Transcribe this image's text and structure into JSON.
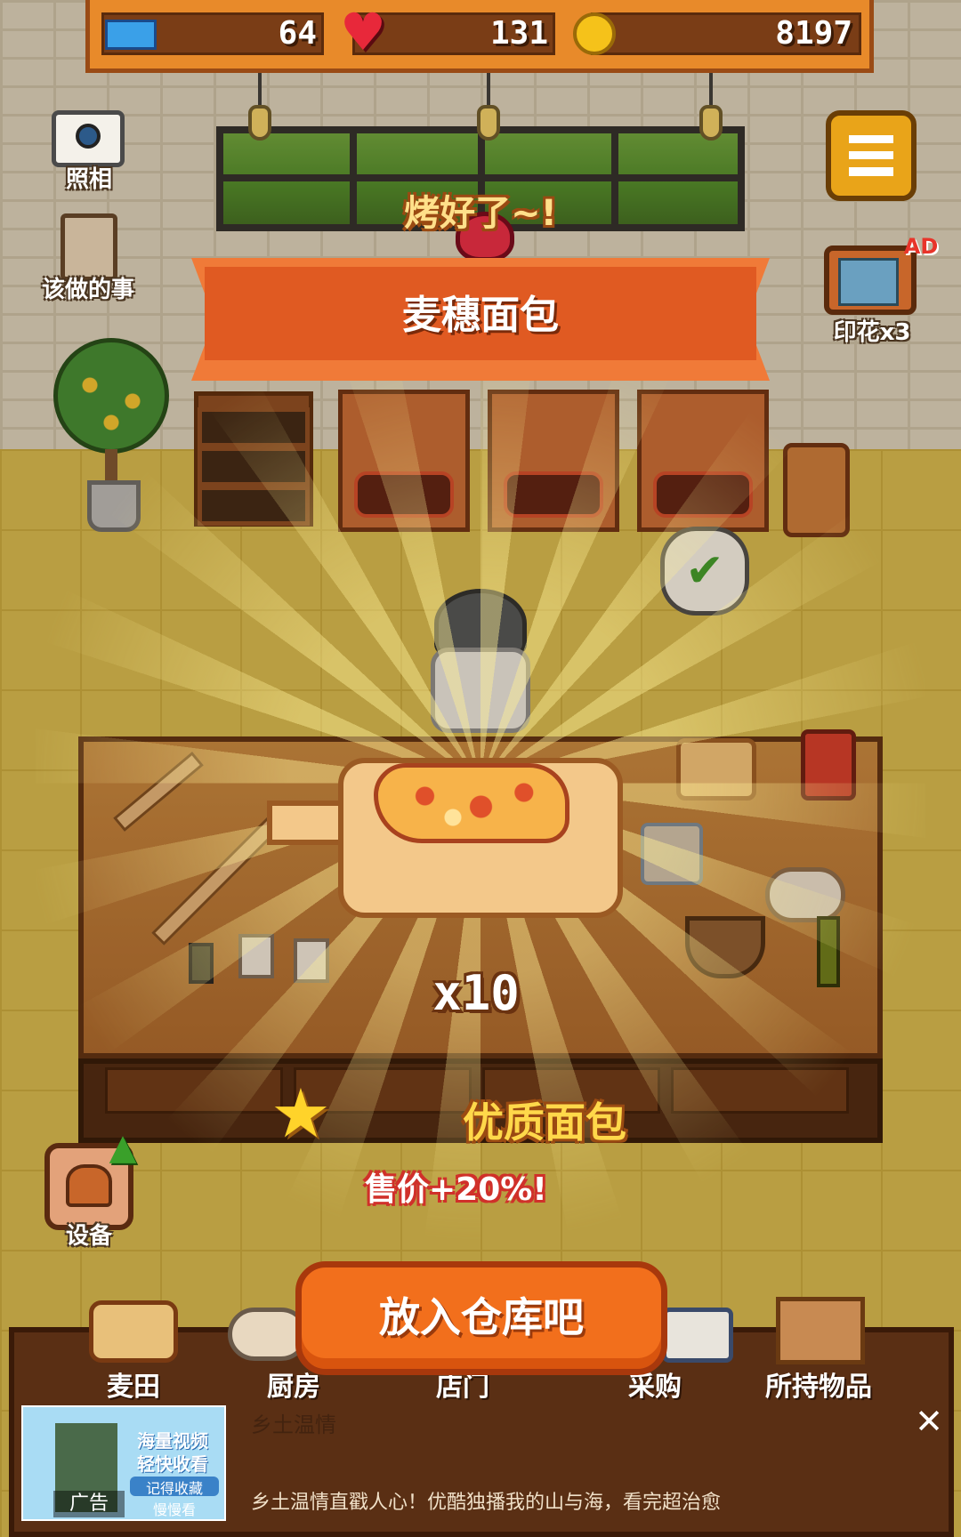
{
  "resources": {
    "tickets": "64",
    "hearts": "131",
    "coins": "8197"
  },
  "side_buttons": {
    "photo": "照相",
    "todo": "该做的事",
    "stamp_ad": "印花x3",
    "ad_badge": "AD",
    "equipment": "设备"
  },
  "result": {
    "baked_text": "烤好了~!",
    "bread_name": "麦穗面包",
    "quantity": "x10",
    "quality_label": "优质面包",
    "price_bonus": "售价+20%!"
  },
  "main_button": "放入仓库吧",
  "bottom_nav": [
    {
      "label": "麦田"
    },
    {
      "label": "厨房"
    },
    {
      "label": "店门"
    },
    {
      "label": "采购"
    },
    {
      "label": "所持物品"
    }
  ],
  "ad": {
    "label": "广告",
    "headline": "乡土温情直戳人心！优酷独播我的山与海，看完超治愈",
    "faint": "乡土温情",
    "thumb_line1": "海量视频",
    "thumb_line2": "轻快收看",
    "thumb_line3": "记得收藏",
    "thumb_line4": "慢慢看"
  },
  "colors": {
    "accent_orange": "#f26f1c",
    "ribbon": "#e05a22",
    "quality_gold": "#ffd84a",
    "price_red": "#d0302a"
  },
  "icons": [
    "ticket-icon",
    "heart-icon",
    "coin-icon",
    "camera-icon",
    "clipboard-icon",
    "menu-icon",
    "tv-icon",
    "oven-icon",
    "star-icon",
    "close-icon",
    "check-icon"
  ]
}
